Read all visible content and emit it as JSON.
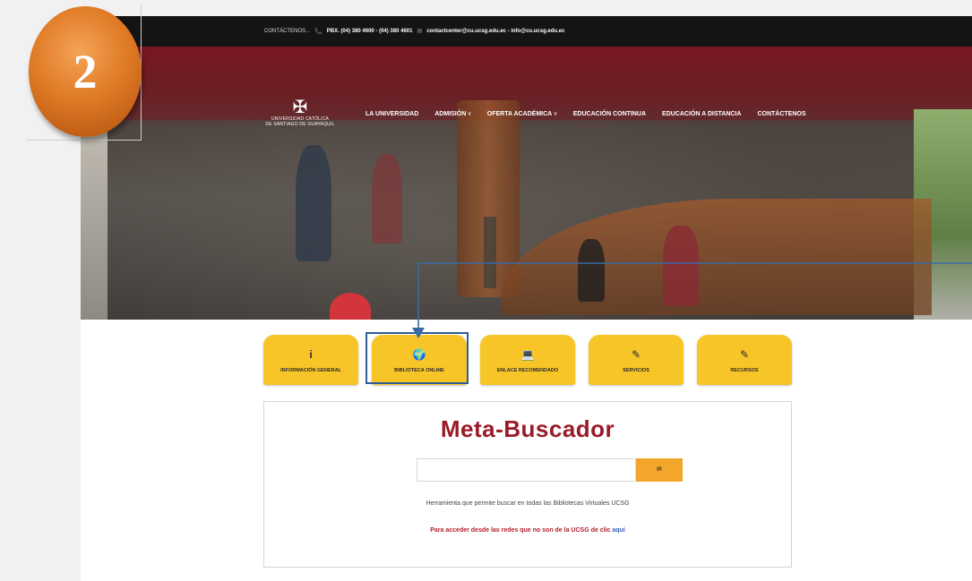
{
  "step_badge": {
    "number": "2",
    "color": "#e07a25"
  },
  "topbar": {
    "contact_label": "CONTÁCTENOS...",
    "phone_icon": "phone-icon",
    "phone": "PBX. (04) 380 4600 - (04) 380 4601",
    "mail_icon": "mail-icon",
    "emails": "contactcenter@cu.ucsg.edu.ec - info@cu.ucsg.edu.ec"
  },
  "logo": {
    "line1": "UNIVERSIDAD CATÓLICA",
    "line2": "DE SANTIAGO DE GUAYAQUIL",
    "icon": "cross-emblem-icon"
  },
  "nav": {
    "items": [
      {
        "label": "LA UNIVERSIDAD",
        "has_dropdown": false
      },
      {
        "label": "ADMISIÓN",
        "has_dropdown": true
      },
      {
        "label": "OFERTA ACADÉMICA",
        "has_dropdown": true
      },
      {
        "label": "EDUCACIÓN CONTINUA",
        "has_dropdown": false
      },
      {
        "label": "EDUCACIÓN A DISTANCIA",
        "has_dropdown": false
      },
      {
        "label": "CONTÁCTENOS",
        "has_dropdown": false
      }
    ]
  },
  "tabs": [
    {
      "label": "INFORMACIÓN GENERAL",
      "icon": "info-icon",
      "glyph": "i"
    },
    {
      "label": "BIBLIOTECA ONLINE",
      "icon": "globe-icon",
      "glyph": "🌍",
      "active": true
    },
    {
      "label": "ENLACE RECOMENDADO",
      "icon": "laptop-icon",
      "glyph": "💻"
    },
    {
      "label": "SERVICIOS",
      "icon": "edit-icon",
      "glyph": "✎"
    },
    {
      "label": "RECURSOS",
      "icon": "edit-icon",
      "glyph": "✎"
    }
  ],
  "search": {
    "title_part1": "Meta",
    "title_part2": "Buscador",
    "input_value": "",
    "button_label": "IR",
    "description": "Herramienta que permite buscar en todas las Bibliotecas Virtuales UCSG",
    "access_text": "Para acceder desde las redes que no son de la UCSG de clic",
    "access_link": "aquí"
  },
  "colors": {
    "accent_yellow": "#f7c528",
    "title_red": "#9b1a28",
    "highlight_blue": "#2e5e95",
    "button_orange": "#f2a72b"
  }
}
